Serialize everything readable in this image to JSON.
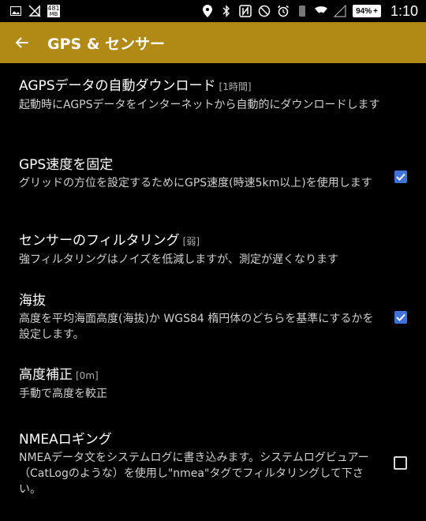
{
  "status_bar": {
    "left_icons": [
      "image-icon",
      "no-signal-icon",
      "memory-icon"
    ],
    "memory_text_top": "481",
    "memory_text_bottom": "MB",
    "right_icons": [
      "location-icon",
      "bluetooth-icon",
      "nfc-icon",
      "do-not-disturb-icon",
      "alarm-icon",
      "vibrate-icon",
      "wifi-icon",
      "cell-signal-icon"
    ],
    "battery": "94%",
    "time": "1:10"
  },
  "app_bar": {
    "title": "GPS & センサー",
    "background": "#b08a14"
  },
  "settings": [
    {
      "title": "AGPSデータの自動ダウンロード",
      "suffix": "[1時間]",
      "summary": "起動時にAGPSデータをインターネットから自動的にダウンロードします",
      "checkbox": null
    },
    {
      "title": "GPS速度を固定",
      "suffix": "",
      "summary": "グリッドの方位を設定するためにGPS速度(時速5km以上)を使用します",
      "checkbox": true
    },
    {
      "title": "センサーのフィルタリング",
      "suffix": "[弱]",
      "summary": "強フィルタリングはノイズを低減しますが、測定が遅くなります",
      "checkbox": null
    },
    {
      "title": "海抜",
      "suffix": "",
      "summary": "高度を平均海面高度(海抜)か WGS84 楕円体のどちらを基準にするかを設定します。",
      "checkbox": true
    },
    {
      "title": "高度補正",
      "suffix": "[0m]",
      "summary": "手動で高度を較正",
      "checkbox": null
    },
    {
      "title": "NMEAロギング",
      "suffix": "",
      "summary": "NMEAデータ文をシステムログに書き込みます。システムログビュアー（CatLogのような）を使用し\"nmea\"タグでフィルタリングして下さい。",
      "checkbox": false
    }
  ],
  "colors": {
    "checkbox_checked": "#3f73d9"
  }
}
